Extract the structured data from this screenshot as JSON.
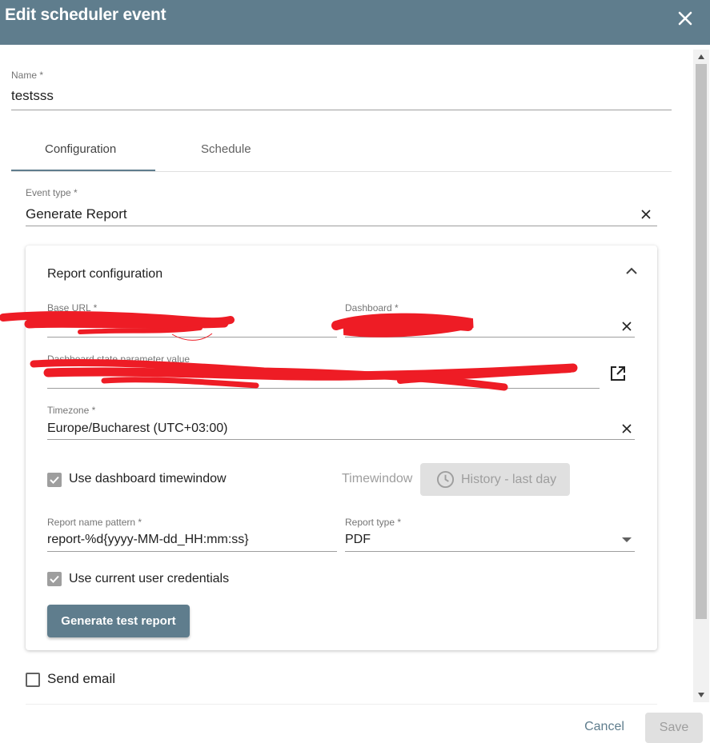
{
  "dialog": {
    "title": "Edit scheduler event"
  },
  "name_field": {
    "label": "Name *",
    "value": "testsss"
  },
  "tabs": [
    {
      "label": "Configuration",
      "active": true
    },
    {
      "label": "Schedule",
      "active": false
    }
  ],
  "event_type": {
    "label": "Event type *",
    "value": "Generate Report"
  },
  "report_config": {
    "title": "Report configuration",
    "base_url": {
      "label": "Base URL *"
    },
    "dashboard": {
      "label": "Dashboard *"
    },
    "state_param": {
      "label": "Dashboard state parameter value"
    },
    "timezone": {
      "label": "Timezone *",
      "value": "Europe/Bucharest (UTC+03:00)"
    },
    "use_dashboard_timewindow": {
      "label": "Use dashboard timewindow",
      "checked": true
    },
    "timewindow": {
      "label": "Timewindow",
      "button_label": "History - last day"
    },
    "report_name_pattern": {
      "label": "Report name pattern *",
      "value": "report-%d{yyyy-MM-dd_HH:mm:ss}"
    },
    "report_type": {
      "label": "Report type *",
      "value": "PDF"
    },
    "use_current_user_credentials": {
      "label": "Use current user credentials",
      "checked": true
    },
    "generate_button": "Generate test report"
  },
  "send_email": {
    "label": "Send email",
    "checked": false
  },
  "actions": {
    "cancel": "Cancel",
    "save": "Save"
  },
  "colors": {
    "primary": "#5f7d8d",
    "redaction": "#ee1c25"
  },
  "icons": [
    "close-icon",
    "clear-icon",
    "chevron-up-icon",
    "open-in-new-icon",
    "clock-icon",
    "dropdown-arrow-icon"
  ]
}
